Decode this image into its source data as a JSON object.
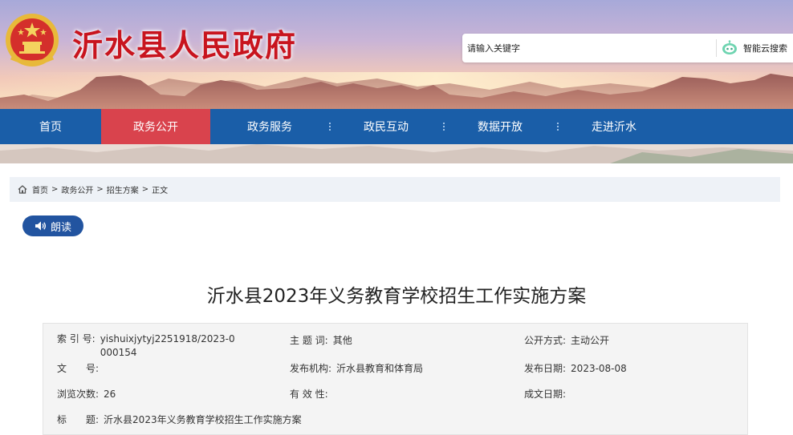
{
  "header": {
    "site_title": "沂水县人民政府",
    "emblem_icon": "national-emblem-icon",
    "search": {
      "placeholder": "请输入关键字",
      "button_label": "智能云搜索",
      "button_icon": "robot-icon"
    }
  },
  "nav": {
    "items": [
      {
        "label": "首页",
        "active": false
      },
      {
        "label": "政务公开",
        "active": true
      },
      {
        "label": "政务服务",
        "active": false
      },
      {
        "label": "政民互动",
        "active": false
      },
      {
        "label": "数据开放",
        "active": false
      },
      {
        "label": "走进沂水",
        "active": false
      }
    ]
  },
  "breadcrumb": {
    "icon": "home-icon",
    "items": [
      "首页",
      "政务公开",
      "招生方案"
    ],
    "separator": ">",
    "current": "正文"
  },
  "read_aloud": {
    "label": "朗读",
    "icon": "speaker-icon"
  },
  "article": {
    "title": "沂水县2023年义务教育学校招生工作实施方案"
  },
  "info": {
    "index_label": "索 引 号:",
    "index_value": "yishuixjytyj2251918/2023-0000154",
    "topic_label": "主 题 词:",
    "topic_value": "其他",
    "open_method_label": "公开方式:",
    "open_method_value": "主动公开",
    "doc_no_label": "文　　号:",
    "doc_no_value": "",
    "publisher_label": "发布机构:",
    "publisher_value": "沂水县教育和体育局",
    "publish_date_label": "发布日期:",
    "publish_date_value": "2023-08-08",
    "views_label": "浏览次数:",
    "views_value": "26",
    "validity_label": "有 效 性:",
    "validity_value": "",
    "created_label": "成文日期:",
    "created_value": "",
    "subject_label": "标　　题:",
    "subject_value": "沂水县2023年义务教育学校招生工作实施方案"
  },
  "colors": {
    "nav_bg": "#1a5ea8",
    "nav_active": "#d9434d",
    "title_red": "#c8141e",
    "read_btn": "#2254a0",
    "breadcrumb_bg": "#eef2f7"
  }
}
